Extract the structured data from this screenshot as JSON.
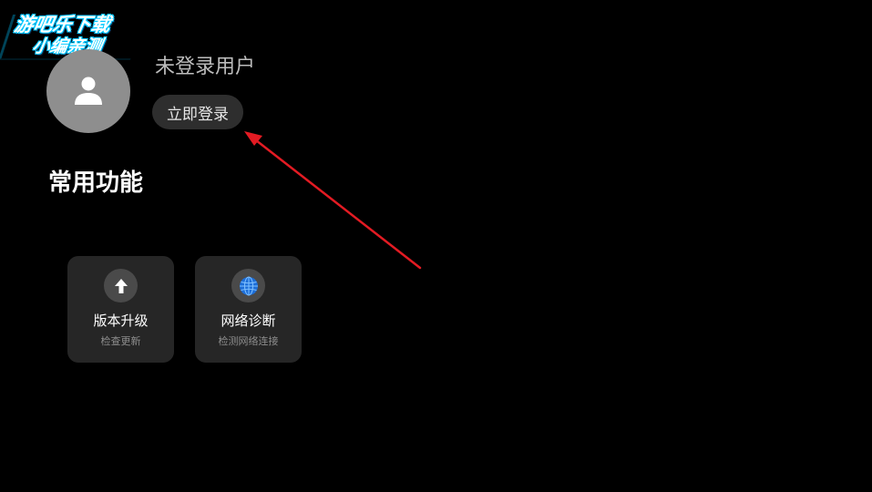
{
  "watermark": {
    "line1": "游吧乐下载",
    "line2": "小编亲测"
  },
  "profile": {
    "username": "未登录用户",
    "login_label": "立即登录",
    "avatar_icon": "user-icon"
  },
  "section": {
    "title": "常用功能"
  },
  "features": [
    {
      "title": "版本升级",
      "subtitle": "检查更新",
      "icon": "upload-arrow-icon"
    },
    {
      "title": "网络诊断",
      "subtitle": "检测网络连接",
      "icon": "globe-icon"
    }
  ],
  "colors": {
    "background": "#000000",
    "avatar": "#8e8e8e",
    "card": "#262626",
    "button": "#2e2e2e",
    "annotation_arrow": "#e31b23",
    "watermark_accent": "#00c3ff",
    "globe": "#1e6fd9"
  }
}
